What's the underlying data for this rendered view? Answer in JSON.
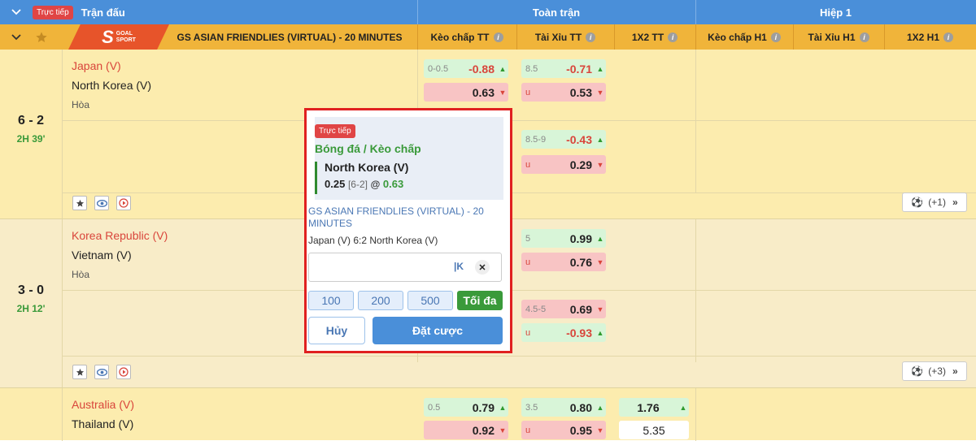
{
  "header": {
    "live_label": "Trực tiếp",
    "match_col": "Trận đấu",
    "full_time": "Toàn trận",
    "first_half": "Hiệp 1"
  },
  "league_bar": {
    "logo_main": "GOAL",
    "logo_sub": "SPORT",
    "league_name": "GS ASIAN FRIENDLIES (VIRTUAL) - 20 MINUTES",
    "cols": [
      "Kèo chấp TT",
      "Tài Xỉu TT",
      "1X2 TT",
      "Kèo chấp H1",
      "Tài Xỉu H1",
      "1X2 H1"
    ]
  },
  "matches": [
    {
      "home": "Japan (V)",
      "away": "North Korea (V)",
      "draw": "Hòa",
      "score": "6 - 2",
      "time": "2H 39'",
      "more": "(+1)",
      "row1": {
        "hdp_line": "0-0.5",
        "hdp_home": "-0.88",
        "hdp_away": "0.63",
        "ou_line": "8.5",
        "ou_over": "-0.71",
        "ou_under_label": "u",
        "ou_under": "0.53"
      },
      "row2": {
        "ou_line": "8.5-9",
        "ou_over": "-0.43",
        "ou_under_label": "u",
        "ou_under": "0.29"
      }
    },
    {
      "home": "Korea Republic (V)",
      "away": "Vietnam (V)",
      "draw": "Hòa",
      "score": "3 - 0",
      "time": "2H 12'",
      "more": "(+3)",
      "row1": {
        "ou_line": "5",
        "ou_over": "0.99",
        "ou_under_label": "u",
        "ou_under": "0.76"
      },
      "row2": {
        "ou_line": "4.5-5",
        "ou_over": "0.69",
        "ou_under_label": "u",
        "ou_under": "-0.93"
      }
    },
    {
      "home": "Australia (V)",
      "away": "Thailand (V)",
      "row1": {
        "hdp_line": "0.5",
        "hdp_home": "0.79",
        "hdp_away": "0.92",
        "ou_line": "3.5",
        "ou_over": "0.80",
        "ou_under_label": "u",
        "ou_under": "0.95",
        "x12_home": "1.76",
        "x12_away": "5.35"
      }
    }
  ],
  "betslip": {
    "live_label": "Trực tiếp",
    "type": "Bóng đá / Kèo chấp",
    "team": "North Korea (V)",
    "line": "0.25",
    "score": "[6-2]",
    "at": "@",
    "price": "0.63",
    "league": "GS ASIAN FRIENDLIES (VIRTUAL) - 20 MINUTES",
    "match": "Japan (V) 6:2  North Korea (V)",
    "stake_value": "",
    "unit": "|K",
    "chips": [
      "100",
      "200",
      "500"
    ],
    "max_label": "Tối đa",
    "cancel_label": "Hủy",
    "place_label": "Đặt cược"
  },
  "colors": {
    "header_blue": "#4a8fd9",
    "league_orange": "#f0b43a",
    "row_yellow": "#fcecae",
    "row_beige": "#f8ecc8",
    "odds_up_green": "#d8f5d8",
    "odds_down_red": "#f8c4c4",
    "popup_border": "#e02020"
  }
}
